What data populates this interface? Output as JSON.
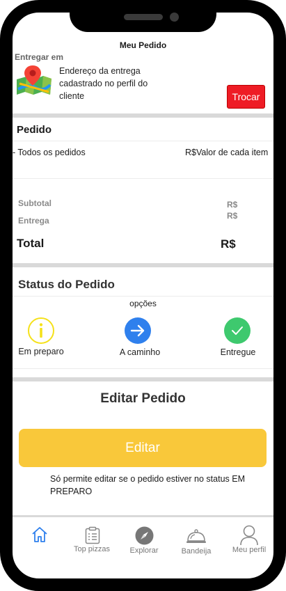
{
  "header": {
    "title": "Meu Pedido"
  },
  "delivery": {
    "label": "Entregar em",
    "address": "Endereço da entrega cadastrado no perfil do cliente",
    "change_button": "Trocar"
  },
  "order": {
    "title": "Pedido",
    "items_label": "- Todos os pedidos",
    "items_value": "R$Valor de cada item",
    "subtotal_label": "Subtotal",
    "subtotal_value": "R$",
    "delivery_label": "Entrega",
    "delivery_value": "R$",
    "total_label": "Total",
    "total_value": "R$"
  },
  "status": {
    "title": "Status do Pedido",
    "options_label": "opções",
    "steps": [
      {
        "label": "Em preparo",
        "icon": "info-icon",
        "color": "#f5e11a"
      },
      {
        "label": "A caminho",
        "icon": "arrow-right-icon",
        "color": "#2f80ed"
      },
      {
        "label": "Entregue",
        "icon": "check-icon",
        "color": "#3ec96e"
      }
    ]
  },
  "edit": {
    "title": "Editar Pedido",
    "button": "Editar",
    "note": "Só permite editar se o pedido estiver no status EM PREPARO",
    "accent": "#f9c83a"
  },
  "nav": [
    {
      "label": "",
      "icon": "home-icon",
      "active": true
    },
    {
      "label": "Top pizzas",
      "icon": "clipboard-icon"
    },
    {
      "label": "Explorar",
      "icon": "compass-icon"
    },
    {
      "label": "Bandeija",
      "icon": "cloche-icon"
    },
    {
      "label": "Meu perfil",
      "icon": "user-icon"
    }
  ]
}
